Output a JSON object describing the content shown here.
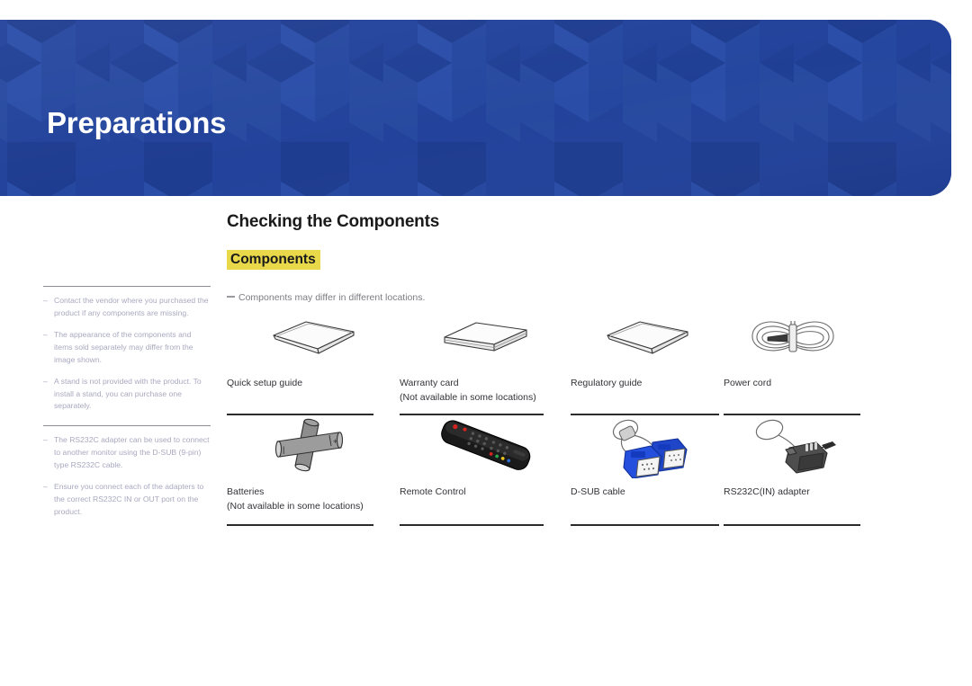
{
  "header": {
    "title": "Preparations",
    "background_color": "#22429b",
    "pattern": "isometric-cubes"
  },
  "content": {
    "section_title": "Checking the Components",
    "subsection_title": "Components",
    "subsection_highlight_color": "#e8d84a",
    "components_note": "Components may differ in different locations."
  },
  "sidebar": {
    "groups": [
      {
        "notes": [
          "Contact the vendor where you purchased the product if any components are missing.",
          "The appearance of the components and items sold separately may differ from the image shown.",
          "A stand is not provided with the product. To install a stand, you can purchase one separately."
        ]
      },
      {
        "notes": [
          "The RS232C adapter can be used to connect to another monitor using the D-SUB (9-pin) type RS232C cable.",
          "Ensure you connect each of the adapters to the correct RS232C IN or OUT port on the product."
        ]
      }
    ],
    "dash": "–"
  },
  "components": {
    "rows": [
      [
        {
          "icon": "quick-setup-guide",
          "label1": "Quick setup guide",
          "label2": ""
        },
        {
          "icon": "warranty-card",
          "label1": "Warranty card",
          "label2": "(Not available in some locations)"
        },
        {
          "icon": "regulatory-guide",
          "label1": "Regulatory guide",
          "label2": ""
        },
        {
          "icon": "power-cord",
          "label1": "Power cord",
          "label2": ""
        }
      ],
      [
        {
          "icon": "batteries",
          "label1": "Batteries",
          "label2": "(Not available in some locations)"
        },
        {
          "icon": "remote-control",
          "label1": "Remote Control",
          "label2": ""
        },
        {
          "icon": "d-sub-cable",
          "label1": "D-SUB cable",
          "label2": ""
        },
        {
          "icon": "rs232c-in-adapter",
          "label1": "RS232C(IN) adapter",
          "label2": ""
        }
      ]
    ]
  }
}
